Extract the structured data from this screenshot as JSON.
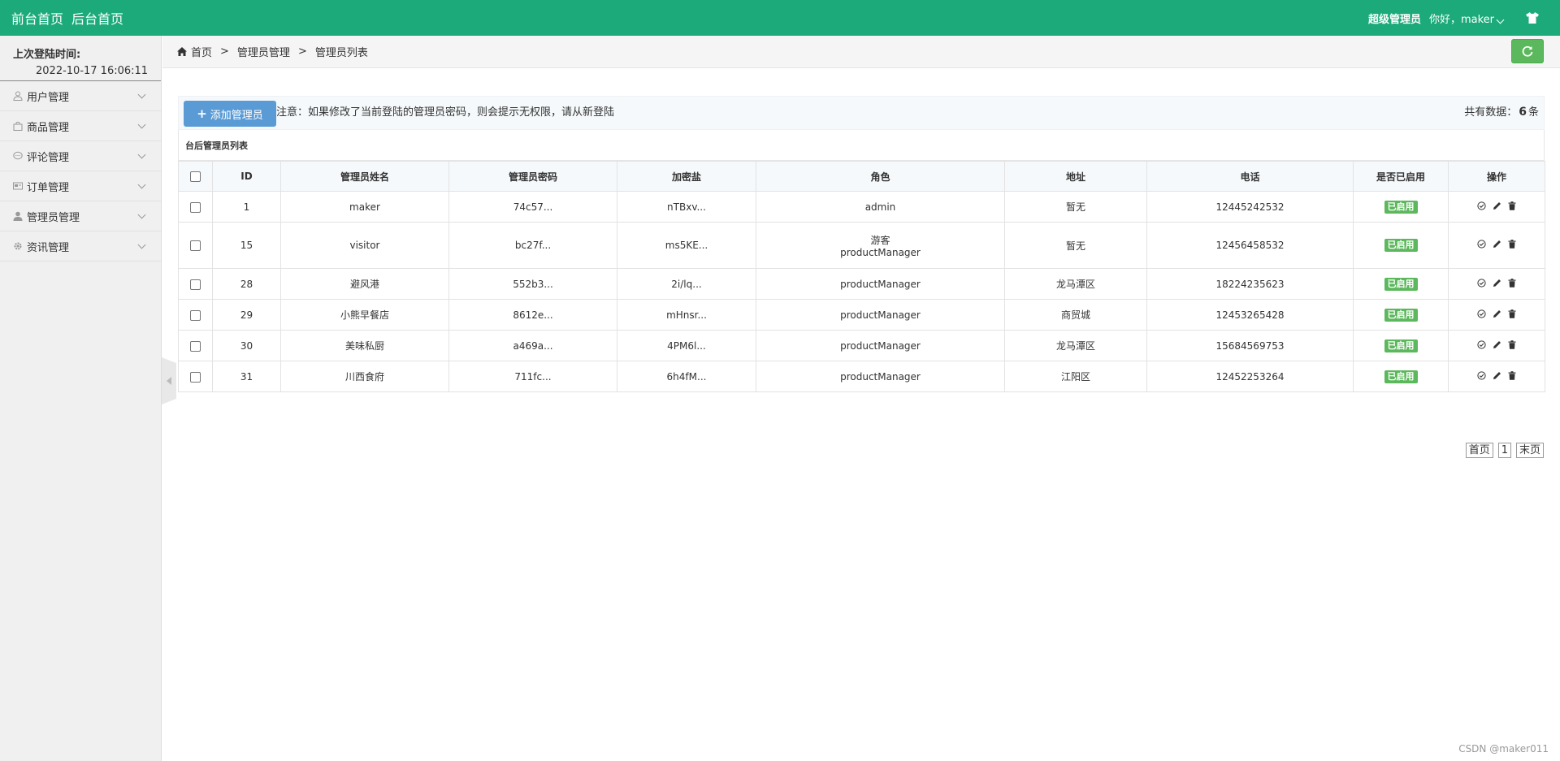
{
  "topbar": {
    "nav": [
      "前台首页",
      "后台首页"
    ],
    "role": "超级管理员",
    "greeting": "你好，maker",
    "bg_color": "#1caa7b",
    "right_icon": "shirt-icon"
  },
  "sidebar": {
    "last_login_label": "上次登陆时间:",
    "last_login_value": "2022-10-17 16:06:11",
    "items": [
      {
        "label": "用户管理",
        "icon": "user-icon"
      },
      {
        "label": "商品管理",
        "icon": "bag-icon"
      },
      {
        "label": "评论管理",
        "icon": "comment-icon"
      },
      {
        "label": "订单管理",
        "icon": "order-icon"
      },
      {
        "label": "管理员管理",
        "icon": "admin-icon"
      },
      {
        "label": "资讯管理",
        "icon": "gear-icon"
      }
    ]
  },
  "breadcrumb": {
    "items": [
      "首页",
      "管理员管理",
      "管理员列表"
    ],
    "separator": ">"
  },
  "toolbar": {
    "add_label": "添加管理员",
    "notice": "注意：如果修改了当前登陆的管理员密码，则会提示无权限，请从新登陆",
    "total_prefix": "共有数据：",
    "total_count": "6",
    "total_suffix": "条"
  },
  "table": {
    "title": "台后管理员列表",
    "headers": [
      "ID",
      "管理员姓名",
      "管理员密码",
      "加密盐",
      "角色",
      "地址",
      "电话",
      "是否已启用",
      "操作"
    ],
    "rows": [
      {
        "id": "1",
        "name": "maker",
        "password": "74c57...",
        "salt": "nTBxv...",
        "role": [
          "admin"
        ],
        "address": "暂无",
        "phone": "12445242532",
        "status": "已启用"
      },
      {
        "id": "15",
        "name": "visitor",
        "password": "bc27f...",
        "salt": "ms5KE...",
        "role": [
          "游客",
          "productManager"
        ],
        "address": "暂无",
        "phone": "12456458532",
        "status": "已启用"
      },
      {
        "id": "28",
        "name": "避风港",
        "password": "552b3...",
        "salt": "2i/lq...",
        "role": [
          "productManager"
        ],
        "address": "龙马潭区",
        "phone": "18224235623",
        "status": "已启用"
      },
      {
        "id": "29",
        "name": "小熊早餐店",
        "password": "8612e...",
        "salt": "mHnsr...",
        "role": [
          "productManager"
        ],
        "address": "商贸城",
        "phone": "12453265428",
        "status": "已启用"
      },
      {
        "id": "30",
        "name": "美味私厨",
        "password": "a469a...",
        "salt": "4PM6l...",
        "role": [
          "productManager"
        ],
        "address": "龙马潭区",
        "phone": "15684569753",
        "status": "已启用"
      },
      {
        "id": "31",
        "name": "川西食府",
        "password": "711fc...",
        "salt": "6h4fM...",
        "role": [
          "productManager"
        ],
        "address": "江阳区",
        "phone": "12452253264",
        "status": "已启用"
      }
    ],
    "status_color": "#5cb85c"
  },
  "pager": {
    "first": "首页",
    "current": "1",
    "last": "末页"
  },
  "watermark": "CSDN @maker011"
}
